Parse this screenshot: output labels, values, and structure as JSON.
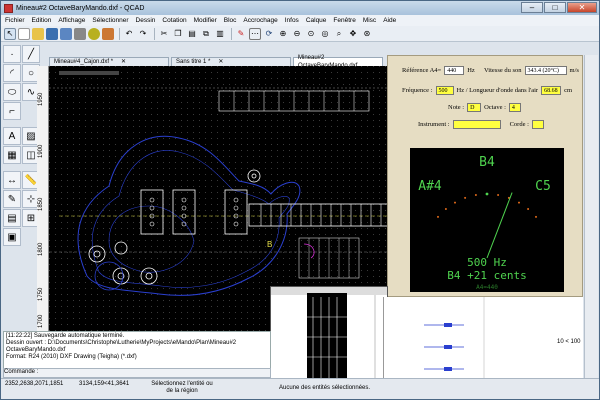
{
  "window": {
    "title": "Mineau#2 OctaveBaryMando.dxf - QCAD"
  },
  "menu": [
    "Fichier",
    "Edition",
    "Affichage",
    "Sélectionner",
    "Dessin",
    "Cotation",
    "Modifier",
    "Bloc",
    "Accrochage",
    "Infos",
    "Calque",
    "Fenêtre",
    "Misc",
    "Aide"
  ],
  "tabs": [
    {
      "label": "Mineau#4_Cajon.dxf *",
      "active": false
    },
    {
      "label": "Sans titre 1 *",
      "active": false
    },
    {
      "label": "Mineau#2 OctaveBaryMando.dxf",
      "active": true
    }
  ],
  "ruler": {
    "v_ticks": [
      "1950",
      "1900",
      "1850",
      "1800",
      "1750",
      "1700"
    ]
  },
  "canvas": {
    "marker_label": "B"
  },
  "tuner": {
    "ref_label": "Référence A4=",
    "ref_value": "440",
    "ref_unit": "Hz",
    "speed_label": "Vitesse du son",
    "speed_value": "343.4 (20°C)",
    "speed_unit": "m/s",
    "freq_label": "Fréquence :",
    "freq_value": "500",
    "freq_mid": "Hz / Longueur d'onde dans l'air",
    "wave_value": "68.68",
    "wave_unit": "cm",
    "note_label": "Note :",
    "note_value": "D",
    "octave_label": "Octave :",
    "octave_value": "4",
    "instrument_label": "Instrument :",
    "instrument_value": "",
    "corde_label": "Corde :",
    "corde_value": "",
    "gauge": {
      "note_center": "B4",
      "note_left": "A#4",
      "note_right": "C5",
      "freq_text": "500 Hz",
      "cents_text": "B4 +21 cents",
      "ref_text": "A4=440",
      "needle_cents": 21
    }
  },
  "log": {
    "lines": [
      "[11:22:22] Sauvegarde automatique terminé.",
      "Dessin ouvert : D:\\Documents\\Christophe\\Lutherie\\MyProjects\\eMando\\Plan\\Mineau#2 OctaveBaryMando.dxf",
      "Format: R24 (2010) DXF Drawing (Teigha) (*.dxf)"
    ],
    "command_label": "Commande :"
  },
  "status": {
    "coord_abs": "2352,2638,2071,1851",
    "coord_rel": "3134,159<41,3641",
    "hint": "Sélectionnez l'entité ou de la région",
    "selection": "Aucune des entités sélectionnées.",
    "zoom": "10 < 100"
  },
  "colors": {
    "canvas_bg": "#000000",
    "body_outline": "#2a3fcf",
    "drawing_white": "#ffffff",
    "tuner_bg": "#e6ddc3",
    "gauge_green": "#4fd34f",
    "field_yellow": "#ffff40"
  }
}
